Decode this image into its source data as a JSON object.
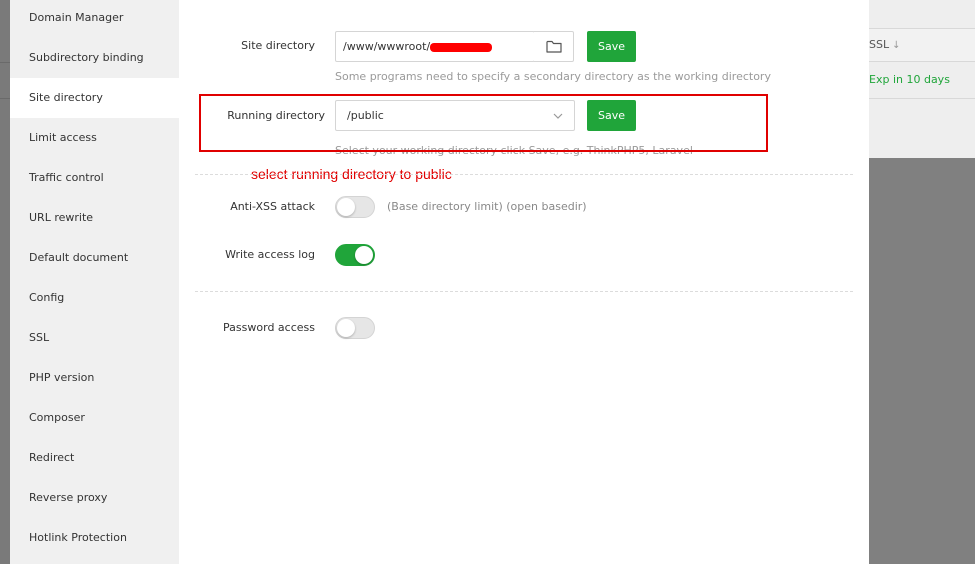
{
  "sidebar": {
    "items": [
      {
        "label": "Domain Manager"
      },
      {
        "label": "Subdirectory binding"
      },
      {
        "label": "Site directory",
        "active": true
      },
      {
        "label": "Limit access"
      },
      {
        "label": "Traffic control"
      },
      {
        "label": "URL rewrite"
      },
      {
        "label": "Default document"
      },
      {
        "label": "Config"
      },
      {
        "label": "SSL"
      },
      {
        "label": "PHP version"
      },
      {
        "label": "Composer"
      },
      {
        "label": "Redirect"
      },
      {
        "label": "Reverse proxy"
      },
      {
        "label": "Hotlink Protection"
      }
    ]
  },
  "site_directory": {
    "label": "Site directory",
    "value": "/www/wwwroot/",
    "save_label": "Save",
    "hint": "Some programs need to specify a secondary directory as the working directory"
  },
  "running_directory": {
    "label": "Running directory",
    "value": "/public",
    "save_label": "Save",
    "hint": "Select your working directory click Save, e.g. ThinkPHP5, Laravel"
  },
  "annotation": {
    "text": "select running directory to public",
    "color": "#e00000"
  },
  "anti_xss": {
    "label": "Anti-XSS attack",
    "hint": "(Base directory limit) (open basedir)",
    "enabled": false
  },
  "write_access_log": {
    "label": "Write access log",
    "enabled": true
  },
  "password_access": {
    "label": "Password access",
    "enabled": false
  },
  "background": {
    "ssl_header": "SSL",
    "ssl_value": "Exp in 10 days"
  },
  "colors": {
    "accent": "#20a53a",
    "annotation": "#e00000"
  }
}
